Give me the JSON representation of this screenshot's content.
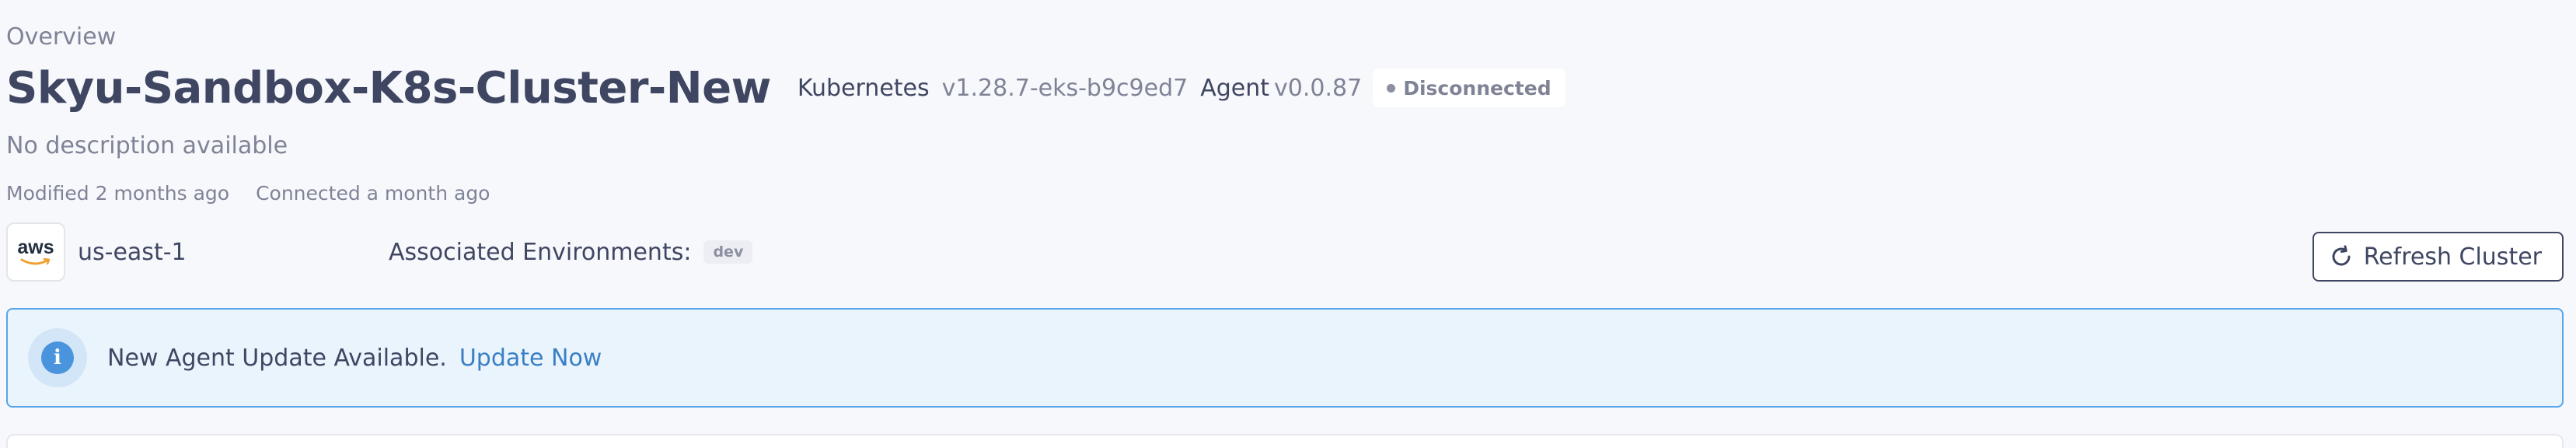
{
  "breadcrumb": {
    "label": "Overview"
  },
  "cluster": {
    "name": "Skyu-Sandbox-K8s-Cluster-New",
    "kubernetes_label": "Kubernetes",
    "kubernetes_version": "v1.28.7-eks-b9c9ed7",
    "agent_label": "Agent",
    "agent_version": "v0.0.87",
    "status": "Disconnected",
    "status_color": "#8c90a0",
    "description": "No description available",
    "modified": "Modified 2 months ago",
    "connected": "Connected a month ago"
  },
  "provider": {
    "logo_text": "aws",
    "region": "us-east-1",
    "environments_label": "Associated Environments:",
    "environments": [
      "dev"
    ]
  },
  "actions": {
    "refresh_label": "Refresh Cluster",
    "refresh_icon": "refresh-icon"
  },
  "alert": {
    "icon": "info-icon",
    "message": "New Agent Update Available.",
    "link_label": "Update Now",
    "accent_color": "#55a6ea",
    "link_color": "#3a7fc5"
  }
}
